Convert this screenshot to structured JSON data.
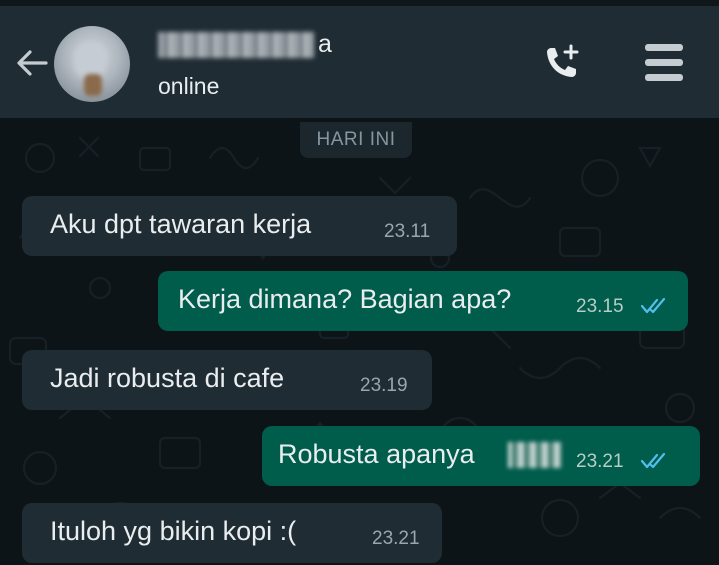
{
  "header": {
    "contact_name_visible": "a",
    "status": "online",
    "icons": {
      "back": "arrow-left-icon",
      "call": "add-call-icon",
      "menu": "menu-icon"
    }
  },
  "chat": {
    "date_label": "HARI INI",
    "messages": [
      {
        "direction": "incoming",
        "text": "Aku dpt tawaran kerja",
        "time": "23.11"
      },
      {
        "direction": "outgoing",
        "text": "Kerja dimana? Bagian apa?",
        "time": "23.15",
        "status": "read"
      },
      {
        "direction": "incoming",
        "text": "Jadi robusta di cafe",
        "time": "23.19"
      },
      {
        "direction": "outgoing",
        "text": "Robusta apanya",
        "time": "23.21",
        "status": "read"
      },
      {
        "direction": "incoming",
        "text": "Ituloh yg bikin kopi :(",
        "time": "23.21"
      }
    ]
  },
  "colors": {
    "header_bg": "#1f2c33",
    "incoming_bubble": "#1f2c33",
    "outgoing_bubble": "#005c4b",
    "read_ticks": "#53bdeb"
  }
}
